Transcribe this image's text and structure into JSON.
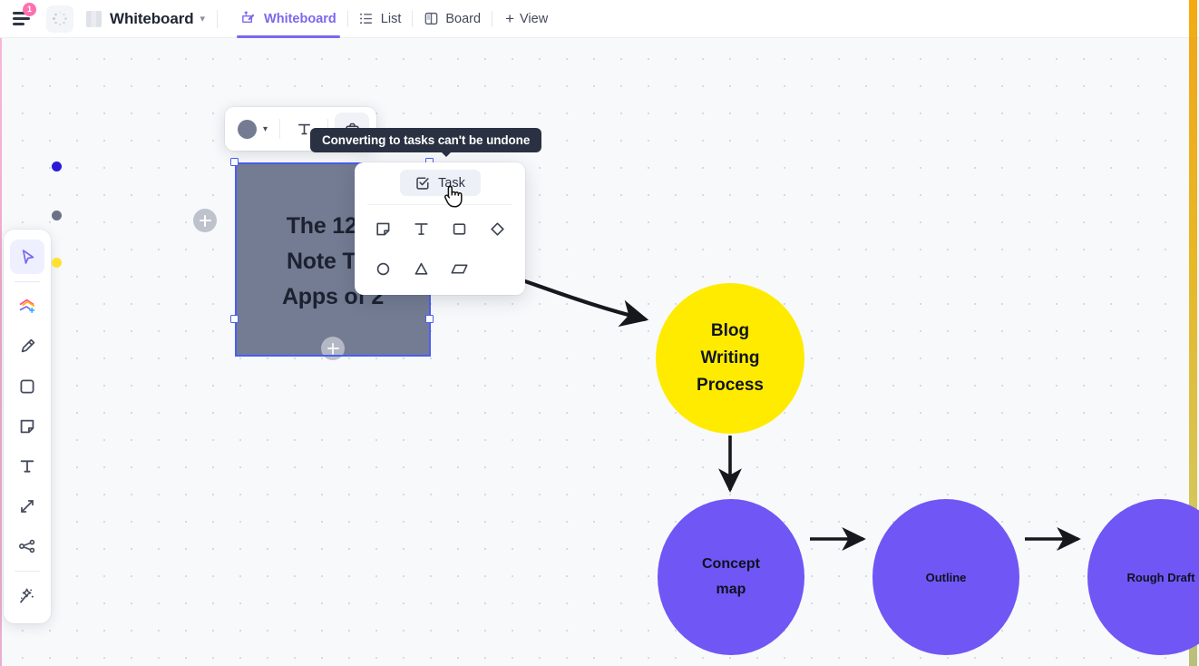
{
  "topbar": {
    "menu_badge": "1",
    "doc_title": "Whiteboard",
    "views": [
      {
        "label": "Whiteboard",
        "icon": "whiteboard-pen-icon",
        "active": true
      },
      {
        "label": "List",
        "icon": "list-icon",
        "active": false
      },
      {
        "label": "Board",
        "icon": "board-columns-icon",
        "active": false
      }
    ],
    "add_view_label": "View",
    "add_view_plus": "+"
  },
  "toolrail": {
    "tools": [
      {
        "name": "select-tool",
        "label": "Select",
        "active": true
      },
      {
        "name": "shapes-library-tool",
        "label": "Shapes library",
        "active": false
      },
      {
        "name": "pen-tool",
        "label": "Pen",
        "active": false,
        "dot_color": "#2a1ad8"
      },
      {
        "name": "square-tool",
        "label": "Square",
        "active": false,
        "dot_color": "#6b7288"
      },
      {
        "name": "sticky-note-tool",
        "label": "Sticky note",
        "active": false,
        "dot_color": "#ffe033"
      },
      {
        "name": "text-tool",
        "label": "Text",
        "active": false
      },
      {
        "name": "connector-tool",
        "label": "Connector",
        "active": false
      },
      {
        "name": "mindmap-tool",
        "label": "Mind map",
        "active": false
      },
      {
        "name": "magic-tool",
        "label": "AI magic",
        "active": false
      }
    ]
  },
  "element_toolbar": {
    "color_swatch": "#737c92",
    "caret": "▾",
    "items": [
      {
        "name": "color-picker",
        "label": ""
      },
      {
        "name": "text-format",
        "label": "T"
      },
      {
        "name": "convert-to-task",
        "label": ""
      }
    ]
  },
  "tooltip": {
    "text": "Converting to tasks can't be undone"
  },
  "convert_menu": {
    "task_label": "Task",
    "shapes": [
      {
        "name": "sticky-note-shape",
        "glyph": "sticky"
      },
      {
        "name": "text-shape",
        "glyph": "T"
      },
      {
        "name": "square-shape",
        "glyph": "square"
      },
      {
        "name": "diamond-shape",
        "glyph": "diamond"
      },
      {
        "name": "circle-shape",
        "glyph": "circle"
      },
      {
        "name": "triangle-shape",
        "glyph": "triangle"
      },
      {
        "name": "parallelogram-shape",
        "glyph": "parallelogram"
      }
    ]
  },
  "sticky_note": {
    "text": "The 12 B\nNote Tak\nApps of 2",
    "fill": "#737c92",
    "selected": true
  },
  "flow": {
    "nodes": [
      {
        "id": "blog",
        "text": "Blog\nWriting\nProcess",
        "color": "#ffeb00"
      },
      {
        "id": "concept",
        "text": "Concept\nmap",
        "color": "#7056f5"
      },
      {
        "id": "outline",
        "text": "Outline",
        "color": "#7056f5"
      },
      {
        "id": "rough",
        "text": "Rough Draft",
        "color": "#7056f5"
      }
    ]
  },
  "colors": {
    "accent_purple": "#7b68ee",
    "badge_pink": "#fd71af",
    "selection_blue": "#4a5ef0",
    "canvas_bg": "#f8f9fb",
    "tooltip_bg": "#2a3142",
    "right_edge": "#f0a81a"
  }
}
